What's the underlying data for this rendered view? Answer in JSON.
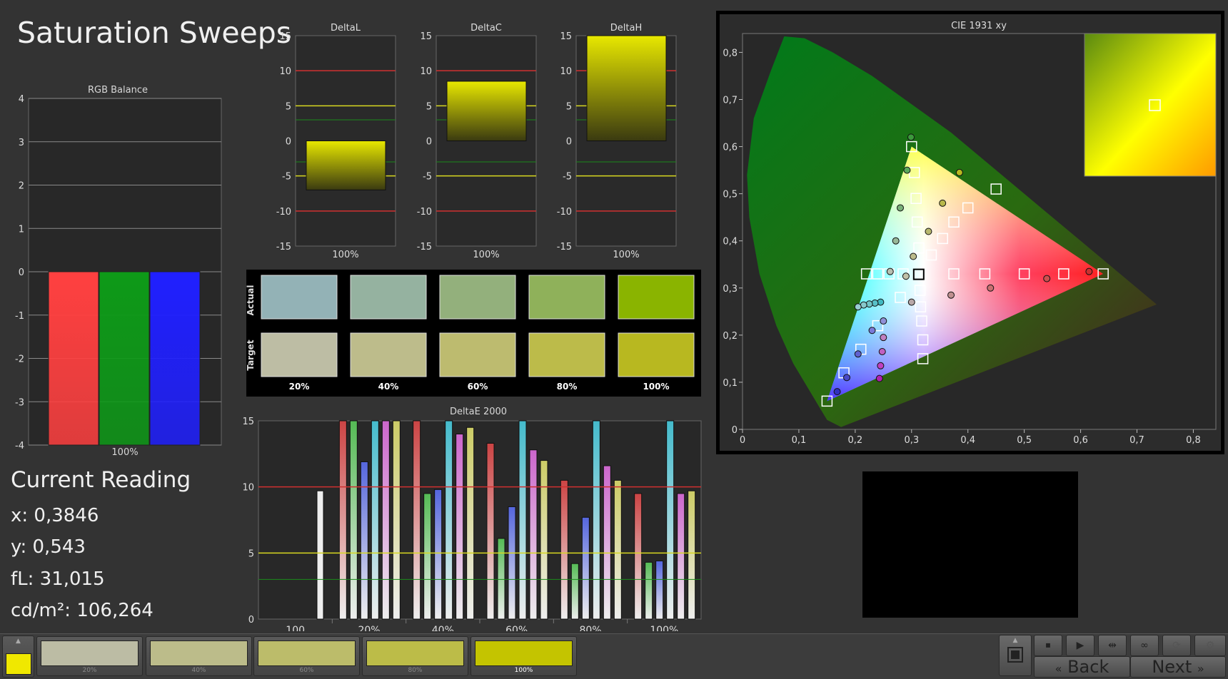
{
  "page": {
    "title": "Saturation Sweeps"
  },
  "rgb_balance": {
    "title": "RGB Balance",
    "y_ticks": [
      "4",
      "3",
      "2",
      "1",
      "0",
      "-1",
      "-2",
      "-3",
      "-4"
    ],
    "x_label": "100%",
    "colors": {
      "red": "#ff4040",
      "green": "#0e9a18",
      "blue": "#2020ff"
    },
    "chart_data": {
      "type": "bar",
      "categories": [
        "R",
        "G",
        "B"
      ],
      "values": [
        -4,
        -4,
        -4
      ],
      "ylim": [
        -4,
        4
      ]
    }
  },
  "delta_charts": [
    {
      "title": "DeltaL",
      "x_label": "100%",
      "value": -7,
      "ticks": [
        "15",
        "10",
        "5",
        "0",
        "-5",
        "-10",
        "-15"
      ]
    },
    {
      "title": "DeltaC",
      "x_label": "100%",
      "value": 8.5,
      "ticks": [
        "15",
        "10",
        "5",
        "0",
        "-5",
        "-10",
        "-15"
      ]
    },
    {
      "title": "DeltaH",
      "x_label": "100%",
      "value": 15,
      "ticks": [
        "15",
        "10",
        "5",
        "0",
        "-5",
        "-10",
        "-15"
      ]
    }
  ],
  "swatches": {
    "actual_label": "Actual",
    "target_label": "Target",
    "items": [
      {
        "label": "20%",
        "actual": "#93b2b6",
        "target": "#bdbda4"
      },
      {
        "label": "40%",
        "actual": "#95b2a0",
        "target": "#bdbc8b"
      },
      {
        "label": "60%",
        "actual": "#93b07c",
        "target": "#bdbb6f"
      },
      {
        "label": "80%",
        "actual": "#8fb15a",
        "target": "#bcbb4a"
      },
      {
        "label": "100%",
        "actual": "#8ab400",
        "target": "#b8b820"
      }
    ]
  },
  "delta_e": {
    "title": "DeltaE 2000",
    "y_ticks": [
      "15",
      "10",
      "5",
      "0"
    ],
    "groups": [
      "100",
      "20%",
      "40%",
      "60%",
      "80%",
      "100%"
    ],
    "chart_data": {
      "type": "bar",
      "categories": [
        "100",
        "20%",
        "40%",
        "60%",
        "80%",
        "100%"
      ],
      "ylim": [
        0,
        15
      ],
      "series": [
        {
          "values": [
            9.7,
            15,
            15,
            13.3,
            10.5,
            9.5
          ],
          "color": "#cc4444"
        },
        {
          "values": [
            0,
            15,
            9.5,
            6.1,
            4.2,
            4.3
          ],
          "color": "#55bb55"
        },
        {
          "values": [
            0,
            11.9,
            9.8,
            8.5,
            7.7,
            4.4
          ],
          "color": "#5566dd"
        },
        {
          "values": [
            0,
            15,
            15,
            15,
            15,
            15
          ],
          "color": "#44bbcc"
        },
        {
          "values": [
            0,
            15,
            14,
            12.8,
            11.6,
            9.5
          ],
          "color": "#cc66cc"
        },
        {
          "values": [
            0,
            15,
            14.5,
            12,
            10.5,
            9.7
          ],
          "color": "#cccc66"
        }
      ]
    }
  },
  "cie": {
    "title": "CIE 1931 xy",
    "x_ticks": [
      "0",
      "0,1",
      "0,2",
      "0,3",
      "0,4",
      "0,5",
      "0,6",
      "0,7",
      "0,8"
    ],
    "y_ticks": [
      "0",
      "0,1",
      "0,2",
      "0,3",
      "0,4",
      "0,5",
      "0,6",
      "0,7",
      "0,8"
    ],
    "chart_data": {
      "type": "scatter",
      "xlim": [
        0,
        0.84
      ],
      "ylim": [
        0,
        0.84
      ],
      "gamut": [
        [
          0.64,
          0.33
        ],
        [
          0.3,
          0.6
        ],
        [
          0.15,
          0.06
        ]
      ],
      "targets": [
        [
          0.3,
          0.6
        ],
        [
          0.305,
          0.545
        ],
        [
          0.308,
          0.49
        ],
        [
          0.31,
          0.44
        ],
        [
          0.313,
          0.385
        ],
        [
          0.45,
          0.51
        ],
        [
          0.4,
          0.47
        ],
        [
          0.375,
          0.44
        ],
        [
          0.355,
          0.405
        ],
        [
          0.335,
          0.37
        ],
        [
          0.64,
          0.33
        ],
        [
          0.57,
          0.33
        ],
        [
          0.5,
          0.33
        ],
        [
          0.43,
          0.33
        ],
        [
          0.375,
          0.33
        ],
        [
          0.22,
          0.33
        ],
        [
          0.24,
          0.33
        ],
        [
          0.26,
          0.33
        ],
        [
          0.285,
          0.33
        ],
        [
          0.15,
          0.06
        ],
        [
          0.18,
          0.12
        ],
        [
          0.21,
          0.17
        ],
        [
          0.24,
          0.22
        ],
        [
          0.28,
          0.28
        ],
        [
          0.32,
          0.15
        ],
        [
          0.32,
          0.19
        ],
        [
          0.318,
          0.23
        ],
        [
          0.316,
          0.26
        ],
        [
          0.315,
          0.295
        ],
        [
          0.3127,
          0.329
        ]
      ],
      "measured": [
        {
          "x": 0.299,
          "y": 0.62,
          "color": "#3c9a3c"
        },
        {
          "x": 0.292,
          "y": 0.55,
          "color": "#5aa85a"
        },
        {
          "x": 0.28,
          "y": 0.47,
          "color": "#78b078"
        },
        {
          "x": 0.272,
          "y": 0.4,
          "color": "#98b898"
        },
        {
          "x": 0.262,
          "y": 0.335,
          "color": "#b8c0b0"
        },
        {
          "x": 0.385,
          "y": 0.545,
          "color": "#b8b820"
        },
        {
          "x": 0.355,
          "y": 0.48,
          "color": "#b8b84a"
        },
        {
          "x": 0.33,
          "y": 0.42,
          "color": "#b8b86e"
        },
        {
          "x": 0.303,
          "y": 0.367,
          "color": "#bcbc8b"
        },
        {
          "x": 0.29,
          "y": 0.325,
          "color": "#c0c0a8"
        },
        {
          "x": 0.615,
          "y": 0.335,
          "color": "#cc3030"
        },
        {
          "x": 0.54,
          "y": 0.32,
          "color": "#cc5050"
        },
        {
          "x": 0.44,
          "y": 0.3,
          "color": "#c87070"
        },
        {
          "x": 0.37,
          "y": 0.285,
          "color": "#c09090"
        },
        {
          "x": 0.3,
          "y": 0.27,
          "color": "#b8a8a8"
        },
        {
          "x": 0.245,
          "y": 0.27,
          "color": "#40b8c0"
        },
        {
          "x": 0.235,
          "y": 0.268,
          "color": "#58c0c8"
        },
        {
          "x": 0.225,
          "y": 0.266,
          "color": "#70c4c8"
        },
        {
          "x": 0.215,
          "y": 0.264,
          "color": "#88c8cc"
        },
        {
          "x": 0.205,
          "y": 0.26,
          "color": "#98ccd0"
        },
        {
          "x": 0.25,
          "y": 0.23,
          "color": "#9090d8"
        },
        {
          "x": 0.23,
          "y": 0.21,
          "color": "#7a7ad8"
        },
        {
          "x": 0.205,
          "y": 0.16,
          "color": "#6060d0"
        },
        {
          "x": 0.185,
          "y": 0.11,
          "color": "#4848c8"
        },
        {
          "x": 0.168,
          "y": 0.08,
          "color": "#3030c0"
        },
        {
          "x": 0.25,
          "y": 0.195,
          "color": "#c080c0"
        },
        {
          "x": 0.248,
          "y": 0.165,
          "color": "#c060c0"
        },
        {
          "x": 0.245,
          "y": 0.135,
          "color": "#c040c0"
        },
        {
          "x": 0.243,
          "y": 0.108,
          "color": "#b020b0"
        }
      ],
      "current": {
        "x": 0.3846,
        "y": 0.543
      }
    }
  },
  "reading": {
    "title": "Current Reading",
    "x": "x: 0,3846",
    "y": "y: 0,543",
    "fl": "fL: 31,015",
    "cdm2": "cd/m²: 106,264"
  },
  "bottom": {
    "current_color": "#f0e800",
    "tabs": [
      {
        "label": "20%",
        "color": "#bcbca4"
      },
      {
        "label": "40%",
        "color": "#bcbc8a"
      },
      {
        "label": "60%",
        "color": "#bcbc6a"
      },
      {
        "label": "80%",
        "color": "#bcbc48"
      },
      {
        "label": "100%",
        "color": "#c4c400"
      }
    ],
    "back_label": "Back",
    "next_label": "Next"
  }
}
